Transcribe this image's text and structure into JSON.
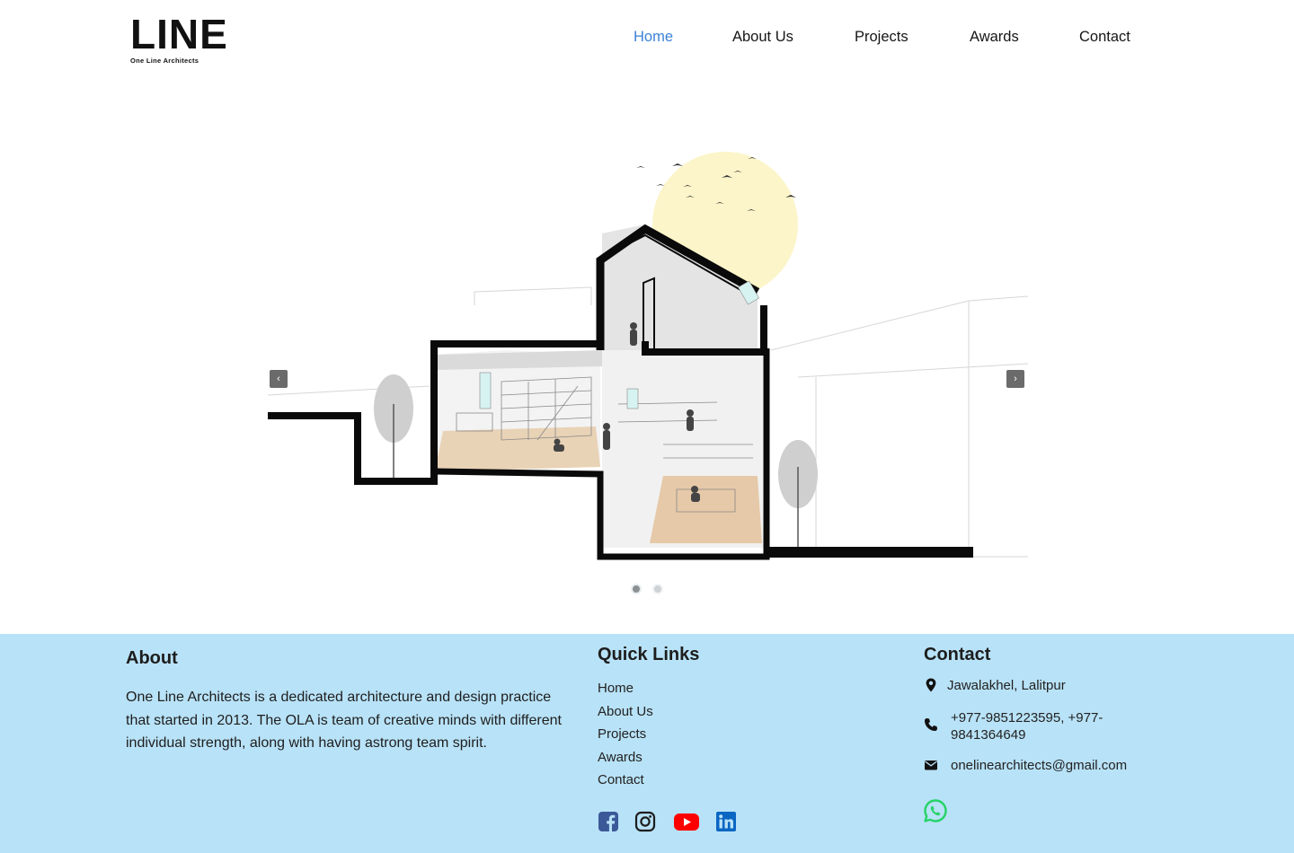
{
  "brand": {
    "logo_mark": "LINE",
    "logo_sub": "One Line Architects"
  },
  "nav": {
    "items": [
      "Home",
      "About Us",
      "Projects",
      "Awards",
      "Contact"
    ],
    "active": "Home",
    "active_color": "#3b82d6"
  },
  "slider": {
    "prev_label": "‹",
    "next_label": "›",
    "slide_count": 2,
    "active_slide": 1
  },
  "footer": {
    "background": "#b8e2f7",
    "about": {
      "title": "About",
      "text": "One Line Architects is a dedicated architecture and design practice that started in 2013. The OLA is team of creative minds with different individual strength, along with having  astrong team spirit."
    },
    "quick_links": {
      "title": "Quick Links",
      "items": [
        "Home",
        "About Us",
        "Projects",
        "Awards",
        "Contact"
      ]
    },
    "social": [
      "facebook-icon",
      "instagram-icon",
      "youtube-icon",
      "linkedin-icon"
    ],
    "contact": {
      "title": "Contact",
      "address": "Jawalakhel, Lalitpur",
      "phone": "+977-9851223595, +977-9841364649",
      "email": "onelinearchitects@gmail.com"
    }
  }
}
